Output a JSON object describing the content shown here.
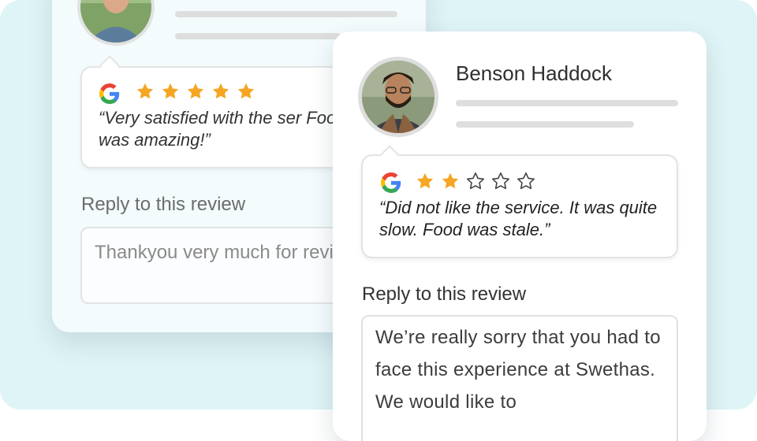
{
  "colors": {
    "background": "#dff4f6",
    "star_filled": "#f5a623",
    "star_empty": "#444444"
  },
  "back_review": {
    "rating": 5,
    "max_rating": 5,
    "quote": "“Very satisfied with the ser Food was amazing!”",
    "reply_label": "Reply to this review",
    "reply_text": "Thankyou very much for review..."
  },
  "front_review": {
    "reviewer_name": "Benson Haddock",
    "rating": 2,
    "max_rating": 5,
    "quote": "“Did not like the service. It was quite slow. Food was stale.”",
    "reply_label": "Reply to this review",
    "reply_text": "We’re really sorry that you had to face this experience at Swethas. We would like to"
  },
  "icons": {
    "review_source": "google-icon",
    "avatar": "user-photo"
  }
}
